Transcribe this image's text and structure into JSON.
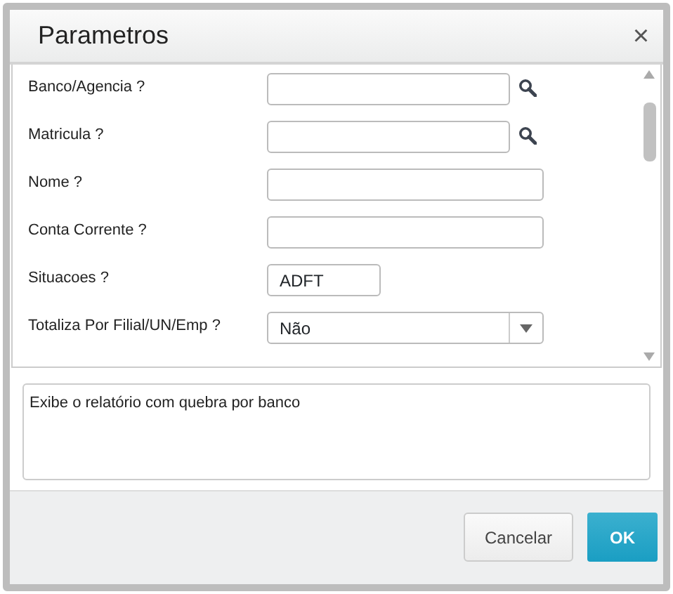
{
  "dialog": {
    "title": "Parametros",
    "close": "×"
  },
  "fields": [
    {
      "label": "Banco/Agencia ?",
      "kind": "lookup"
    },
    {
      "label": "Matricula ?",
      "kind": "lookup"
    },
    {
      "label": "Nome ?",
      "kind": "text"
    },
    {
      "label": "Conta Corrente ?",
      "kind": "text"
    },
    {
      "label": "Situacoes ?",
      "kind": "short",
      "value": "ADFT"
    },
    {
      "label": "Totaliza Por Filial/UN/Emp ?",
      "kind": "select",
      "value": "Não"
    }
  ],
  "description": "Exibe o relatório com quebra por banco",
  "buttons": [
    {
      "label": "Cancelar",
      "kind": "default"
    },
    {
      "label": "OK",
      "kind": "primary"
    }
  ]
}
